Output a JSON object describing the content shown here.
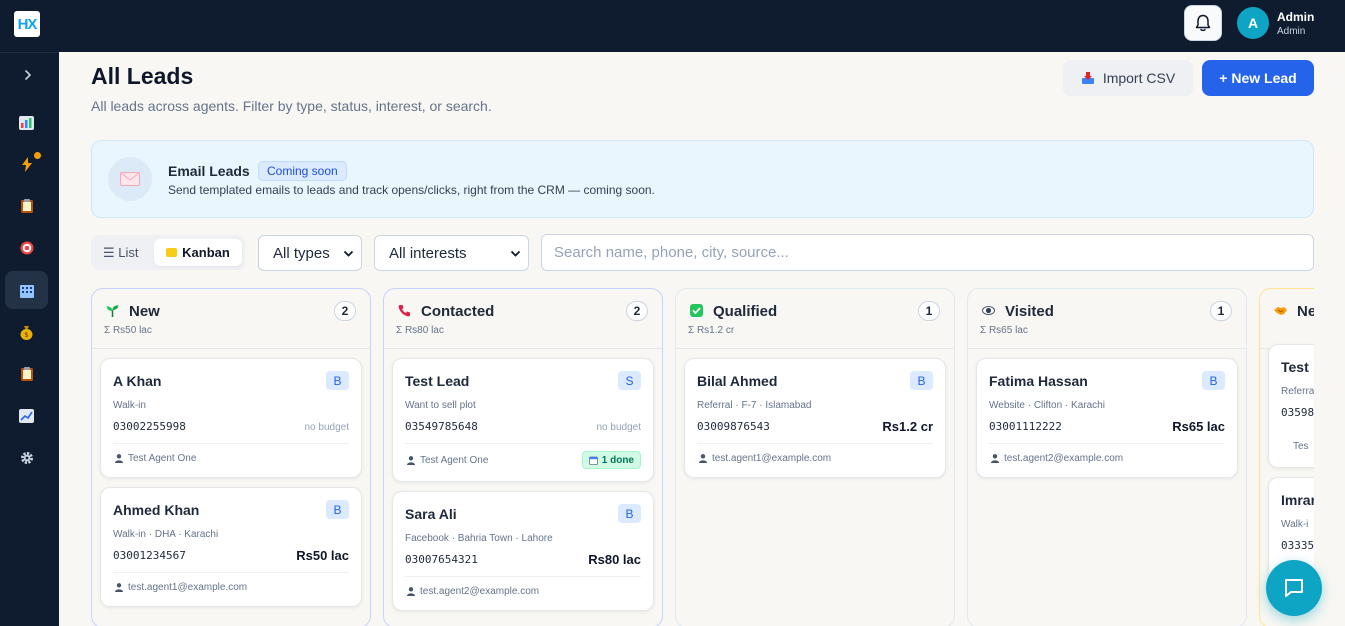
{
  "app": {
    "logo_text": "HX"
  },
  "header": {
    "user_initial": "A",
    "user_name": "Admin",
    "user_role": "Admin"
  },
  "sidebar": {
    "items": [
      {
        "name": "dashboard",
        "icon": "bar-chart-icon",
        "color": "#60a5fa"
      },
      {
        "name": "activity",
        "icon": "lightning-icon",
        "color": "#f59e0b",
        "notification": true
      },
      {
        "name": "tasks",
        "icon": "clipboard-icon",
        "color": "#d97706"
      },
      {
        "name": "targets",
        "icon": "target-icon",
        "color": "#ef4444"
      },
      {
        "name": "leads",
        "icon": "building-icon",
        "color": "#93c5fd",
        "active": true
      },
      {
        "name": "finance",
        "icon": "money-bag-icon",
        "color": "#eab308"
      },
      {
        "name": "reports",
        "icon": "clipboard-icon",
        "color": "#d97706"
      },
      {
        "name": "analytics",
        "icon": "trend-chart-icon",
        "color": "#60a5fa"
      },
      {
        "name": "settings",
        "icon": "gear-icon",
        "color": "#cbd5e1"
      }
    ]
  },
  "page": {
    "title": "All Leads",
    "subtitle": "All leads across agents. Filter by type, status, interest, or search.",
    "import_label": "Import CSV",
    "new_lead_label": "+ New Lead"
  },
  "banner": {
    "title": "Email Leads",
    "badge": "Coming soon",
    "description": "Send templated emails to leads and track opens/clicks, right from the CRM — coming soon."
  },
  "filters": {
    "view_list": "☰ List",
    "view_kanban": "Kanban",
    "type_select": "All types",
    "interest_select": "All interests",
    "search_placeholder": "Search name, phone, city, source..."
  },
  "columns": [
    {
      "title": "New",
      "sum": "Σ Rs50 lac",
      "count": "2",
      "icon_color": "#16a34a",
      "cards": [
        {
          "name": "A Khan",
          "type": "B",
          "source": "Walk-in",
          "phone": "03002255998",
          "budget": "no budget",
          "agent": "Test Agent One"
        },
        {
          "name": "Ahmed Khan",
          "type": "B",
          "source": "Walk-in · DHA · Karachi",
          "phone": "03001234567",
          "budget": "Rs50 lac",
          "agent": "test.agent1@example.com"
        }
      ]
    },
    {
      "title": "Contacted",
      "sum": "Σ Rs80 lac",
      "count": "2",
      "icon_color": "#e11d48",
      "cards": [
        {
          "name": "Test Lead",
          "type": "S",
          "source": "Want to sell plot",
          "phone": "03549785648",
          "budget": "no budget",
          "agent": "Test Agent One",
          "done": "1 done"
        },
        {
          "name": "Sara Ali",
          "type": "B",
          "source": "Facebook · Bahria Town · Lahore",
          "phone": "03007654321",
          "budget": "Rs80 lac",
          "agent": "test.agent2@example.com"
        }
      ]
    },
    {
      "title": "Qualified",
      "sum": "Σ Rs1.2 cr",
      "count": "1",
      "icon_color": "#22c55e",
      "cards": [
        {
          "name": "Bilal Ahmed",
          "type": "B",
          "source": "Referral · F-7 · Islamabad",
          "phone": "03009876543",
          "budget": "Rs1.2 cr",
          "agent": "test.agent1@example.com"
        }
      ]
    },
    {
      "title": "Visited",
      "sum": "Σ Rs65 lac",
      "count": "1",
      "icon_color": "#475569",
      "cards": [
        {
          "name": "Fatima Hassan",
          "type": "B",
          "source": "Website · Clifton · Karachi",
          "phone": "03001112222",
          "budget": "Rs65 lac",
          "agent": "test.agent2@example.com"
        }
      ]
    },
    {
      "title": "Ne",
      "icon_color": "#f59e0b",
      "cards": [
        {
          "name": "Test",
          "source": "Referra",
          "phone": "03598",
          "agent": "Tes"
        },
        {
          "name": "Imran",
          "source": "Walk-i",
          "phone": "03335"
        }
      ]
    }
  ]
}
